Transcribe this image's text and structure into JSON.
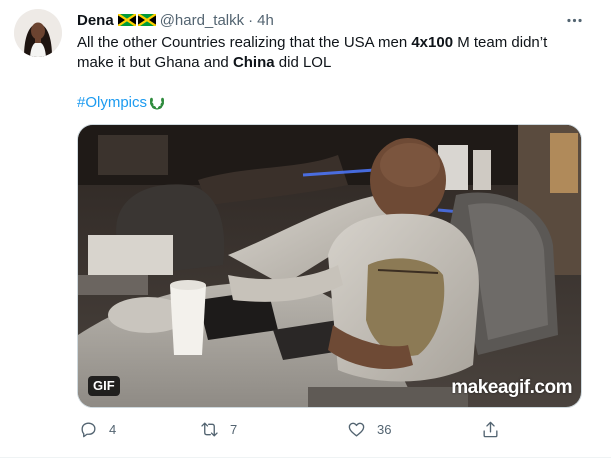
{
  "tweet": {
    "display_name": "Dena",
    "handle": "@hard_talkk",
    "separator": "·",
    "time": "4h",
    "text_line1_a": "All the other Countries realizing that the USA men ",
    "text_line1_b": "4x100",
    "text_line1_c": " M team didn’t",
    "text_line2_a": "make it but Ghana and ",
    "text_line2_b": "China",
    "text_line2_c": " did LOL",
    "hashtag": "#Olympics",
    "flag_icons": [
      "jamaica-flag-icon",
      "jamaica-flag-icon"
    ]
  },
  "media": {
    "badge": "GIF",
    "watermark": "makeagif.com"
  },
  "actions": {
    "reply_count": "4",
    "retweet_count": "7",
    "like_count": "36"
  },
  "colors": {
    "accent": "#1d9bf0",
    "secondary_text": "#536471",
    "primary_text": "#0f1419",
    "border": "#cfd9de"
  }
}
